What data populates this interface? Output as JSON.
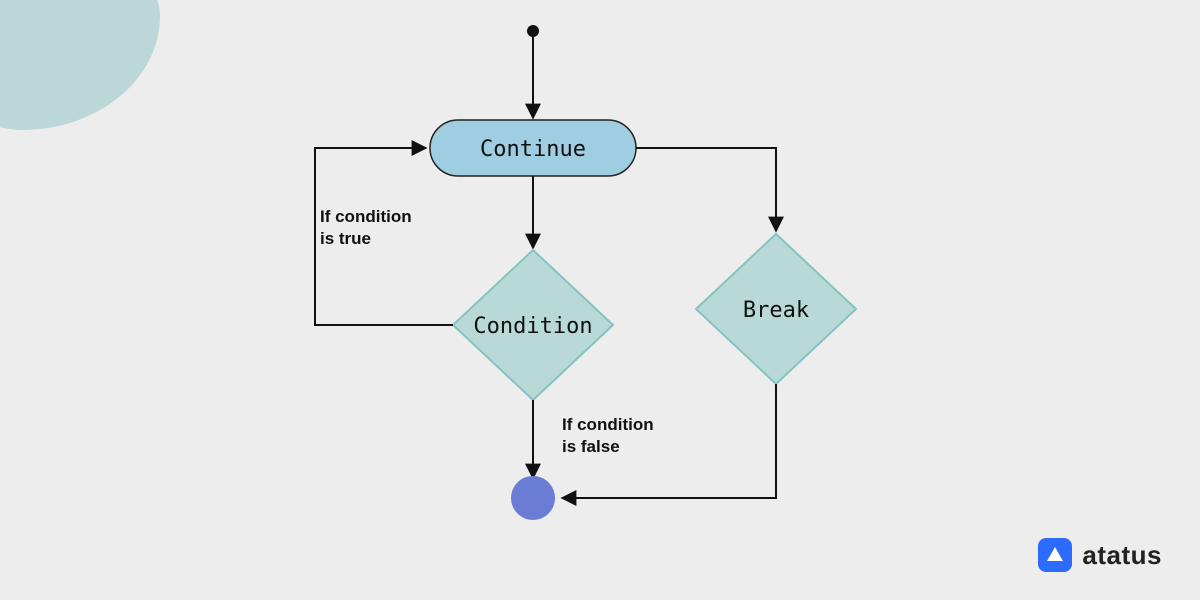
{
  "diagram": {
    "nodes": {
      "continue": "Continue",
      "condition": "Condition",
      "break": "Break"
    },
    "edges": {
      "true_label_line1": "If condition",
      "true_label_line2": "is true",
      "false_label_line1": "If condition",
      "false_label_line2": "is false"
    }
  },
  "brand": {
    "name": "atatus"
  },
  "colors": {
    "bg": "#ededed",
    "blob": "#bcd7d7",
    "continue_fill": "#9fcde2",
    "continue_stroke": "#222",
    "diamond_fill": "#b9d9d6",
    "diamond_stroke": "#83c3c3",
    "end_fill": "#6a7cd4",
    "brand_icon_bg": "#2d6bff"
  }
}
